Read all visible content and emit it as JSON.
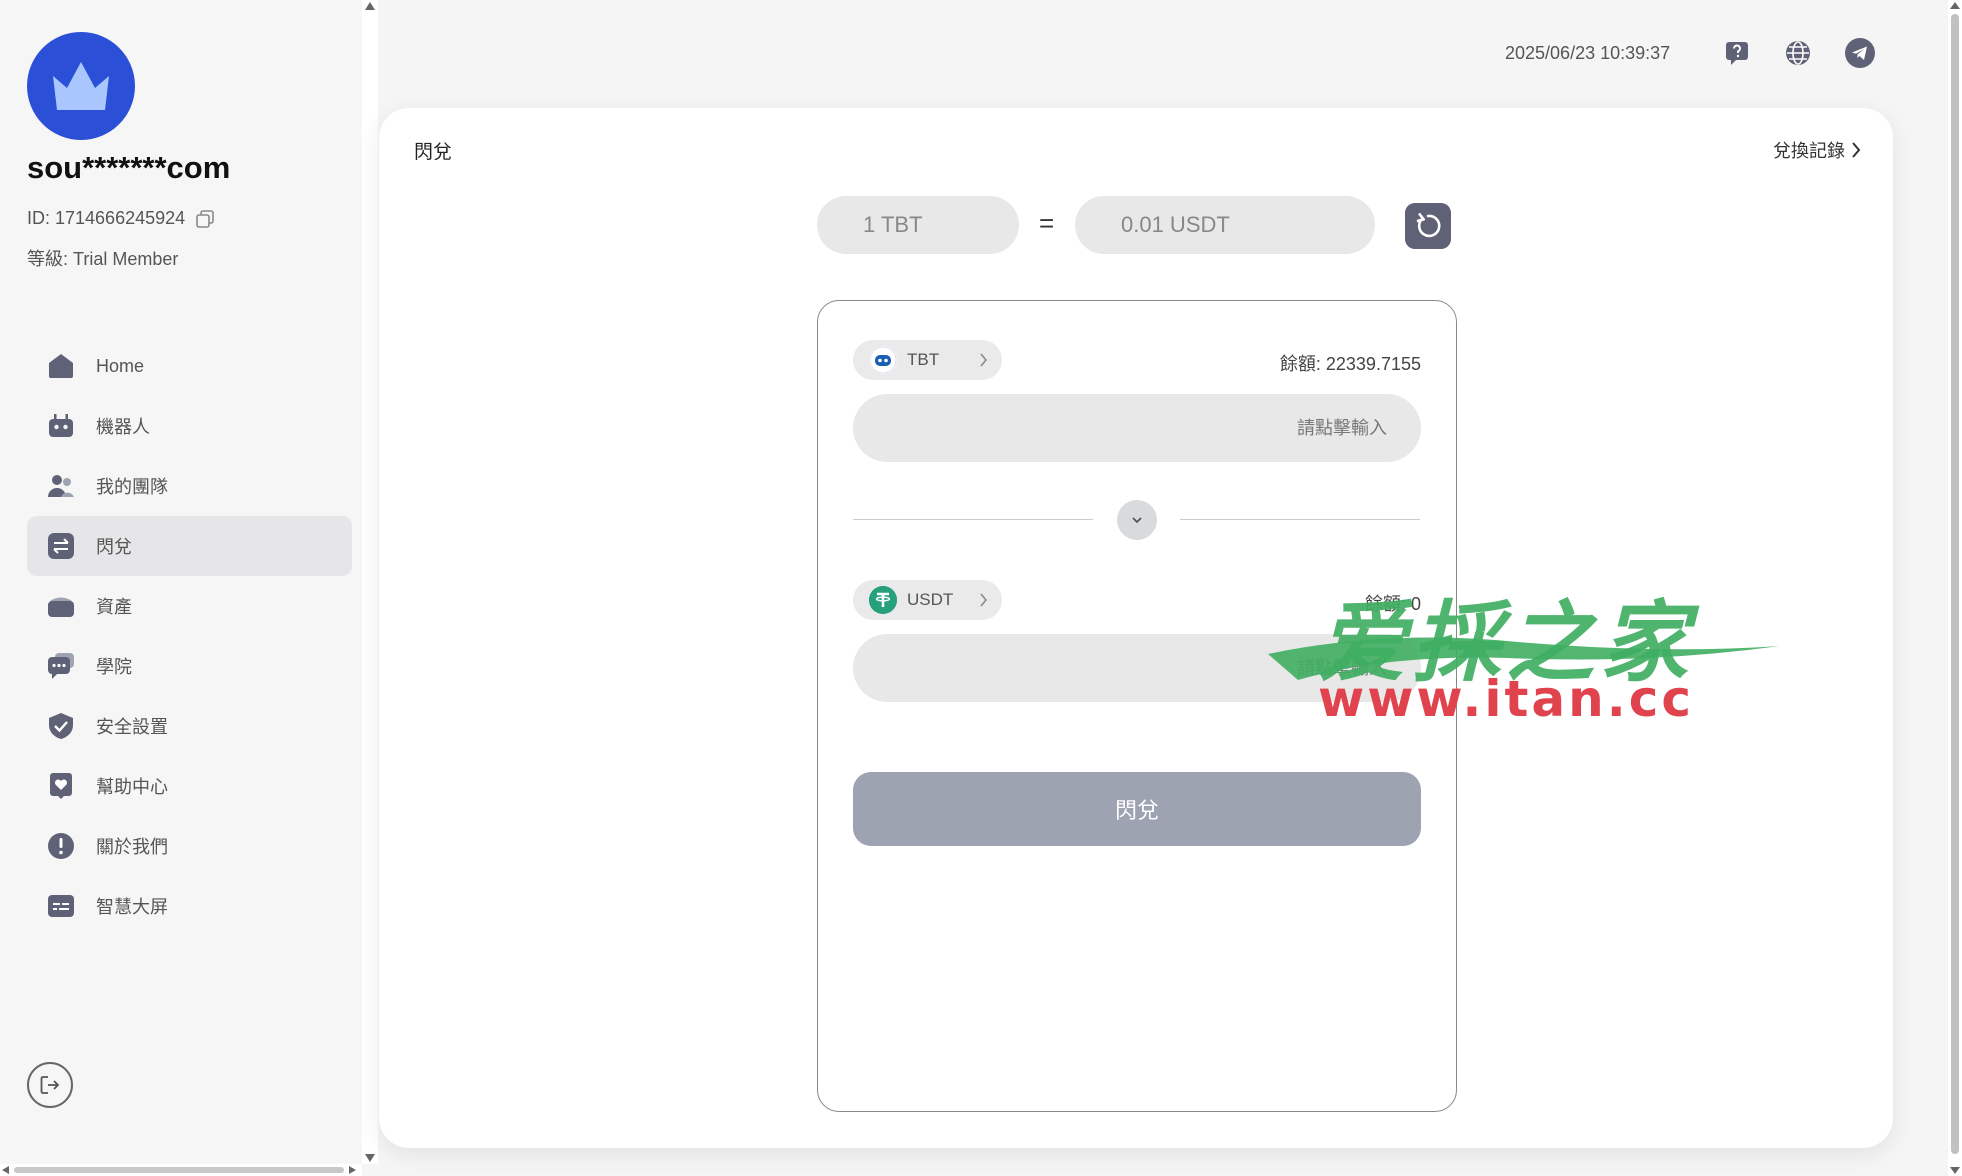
{
  "sidebar": {
    "username": "sou*******com",
    "id_label": "ID: 1714666245924",
    "level_label": "等級: Trial Member",
    "items": [
      {
        "label": "Home",
        "icon": "home-icon"
      },
      {
        "label": "機器人",
        "icon": "robot-icon"
      },
      {
        "label": "我的團隊",
        "icon": "team-icon"
      },
      {
        "label": "閃兌",
        "icon": "exchange-icon",
        "active": true
      },
      {
        "label": "資產",
        "icon": "wallet-icon"
      },
      {
        "label": "學院",
        "icon": "chat-icon"
      },
      {
        "label": "安全設置",
        "icon": "shield-icon"
      },
      {
        "label": "幫助中心",
        "icon": "heart-icon"
      },
      {
        "label": "關於我們",
        "icon": "info-icon"
      },
      {
        "label": "智慧大屏",
        "icon": "screen-icon"
      }
    ]
  },
  "header": {
    "datetime": "2025/06/23 10:39:37",
    "icons": [
      "help-icon",
      "globe-icon",
      "telegram-icon"
    ]
  },
  "card": {
    "title": "閃兌",
    "history_label": "兌換記錄",
    "rate": {
      "from": "1 TBT",
      "equals": "=",
      "to": "0.01 USDT"
    },
    "from": {
      "token": "TBT",
      "balance": "餘額: 22339.7155",
      "placeholder": "請點擊輸入"
    },
    "to": {
      "token": "USDT",
      "balance": "餘額: 0",
      "placeholder": "請點擊輸入"
    },
    "submit_label": "閃兌"
  },
  "watermark": {
    "cn": "爱採之家",
    "url": "www.itan.cc"
  },
  "colors": {
    "avatar": "#2b4fd6",
    "submit": "#9ea3b2",
    "usdt": "#26a17b",
    "tbt": "#1a5fb4"
  }
}
